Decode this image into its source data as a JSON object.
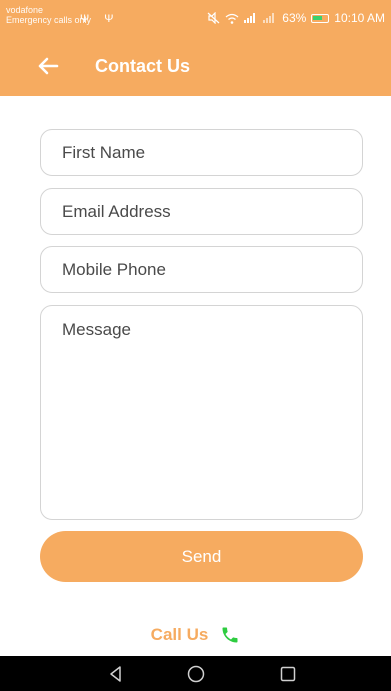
{
  "status_bar": {
    "carrier": "vodafone",
    "carrier_sub": "Emergency calls only",
    "usb_icons": "Ψ Ψ",
    "battery_percent": "63%",
    "time": "10:10 AM",
    "icons": [
      "mute-icon",
      "wifi-icon",
      "signal-icon",
      "battery-icon"
    ]
  },
  "app_bar": {
    "title": "Contact Us",
    "back_icon": "arrow-left-icon"
  },
  "form": {
    "first_name_placeholder": "First Name",
    "email_placeholder": "Email Address",
    "mobile_placeholder": "Mobile Phone",
    "message_placeholder": "Message",
    "send_label": "Send"
  },
  "call_us": {
    "label": "Call Us",
    "icon": "phone-icon"
  },
  "nav_bar": {
    "buttons": [
      "back-triangle-icon",
      "home-circle-icon",
      "recents-square-icon"
    ]
  },
  "colors": {
    "accent": "#f6ab60",
    "phone_green": "#2ecc40",
    "nav_bg": "#000000",
    "field_border": "#d4d4d4"
  }
}
